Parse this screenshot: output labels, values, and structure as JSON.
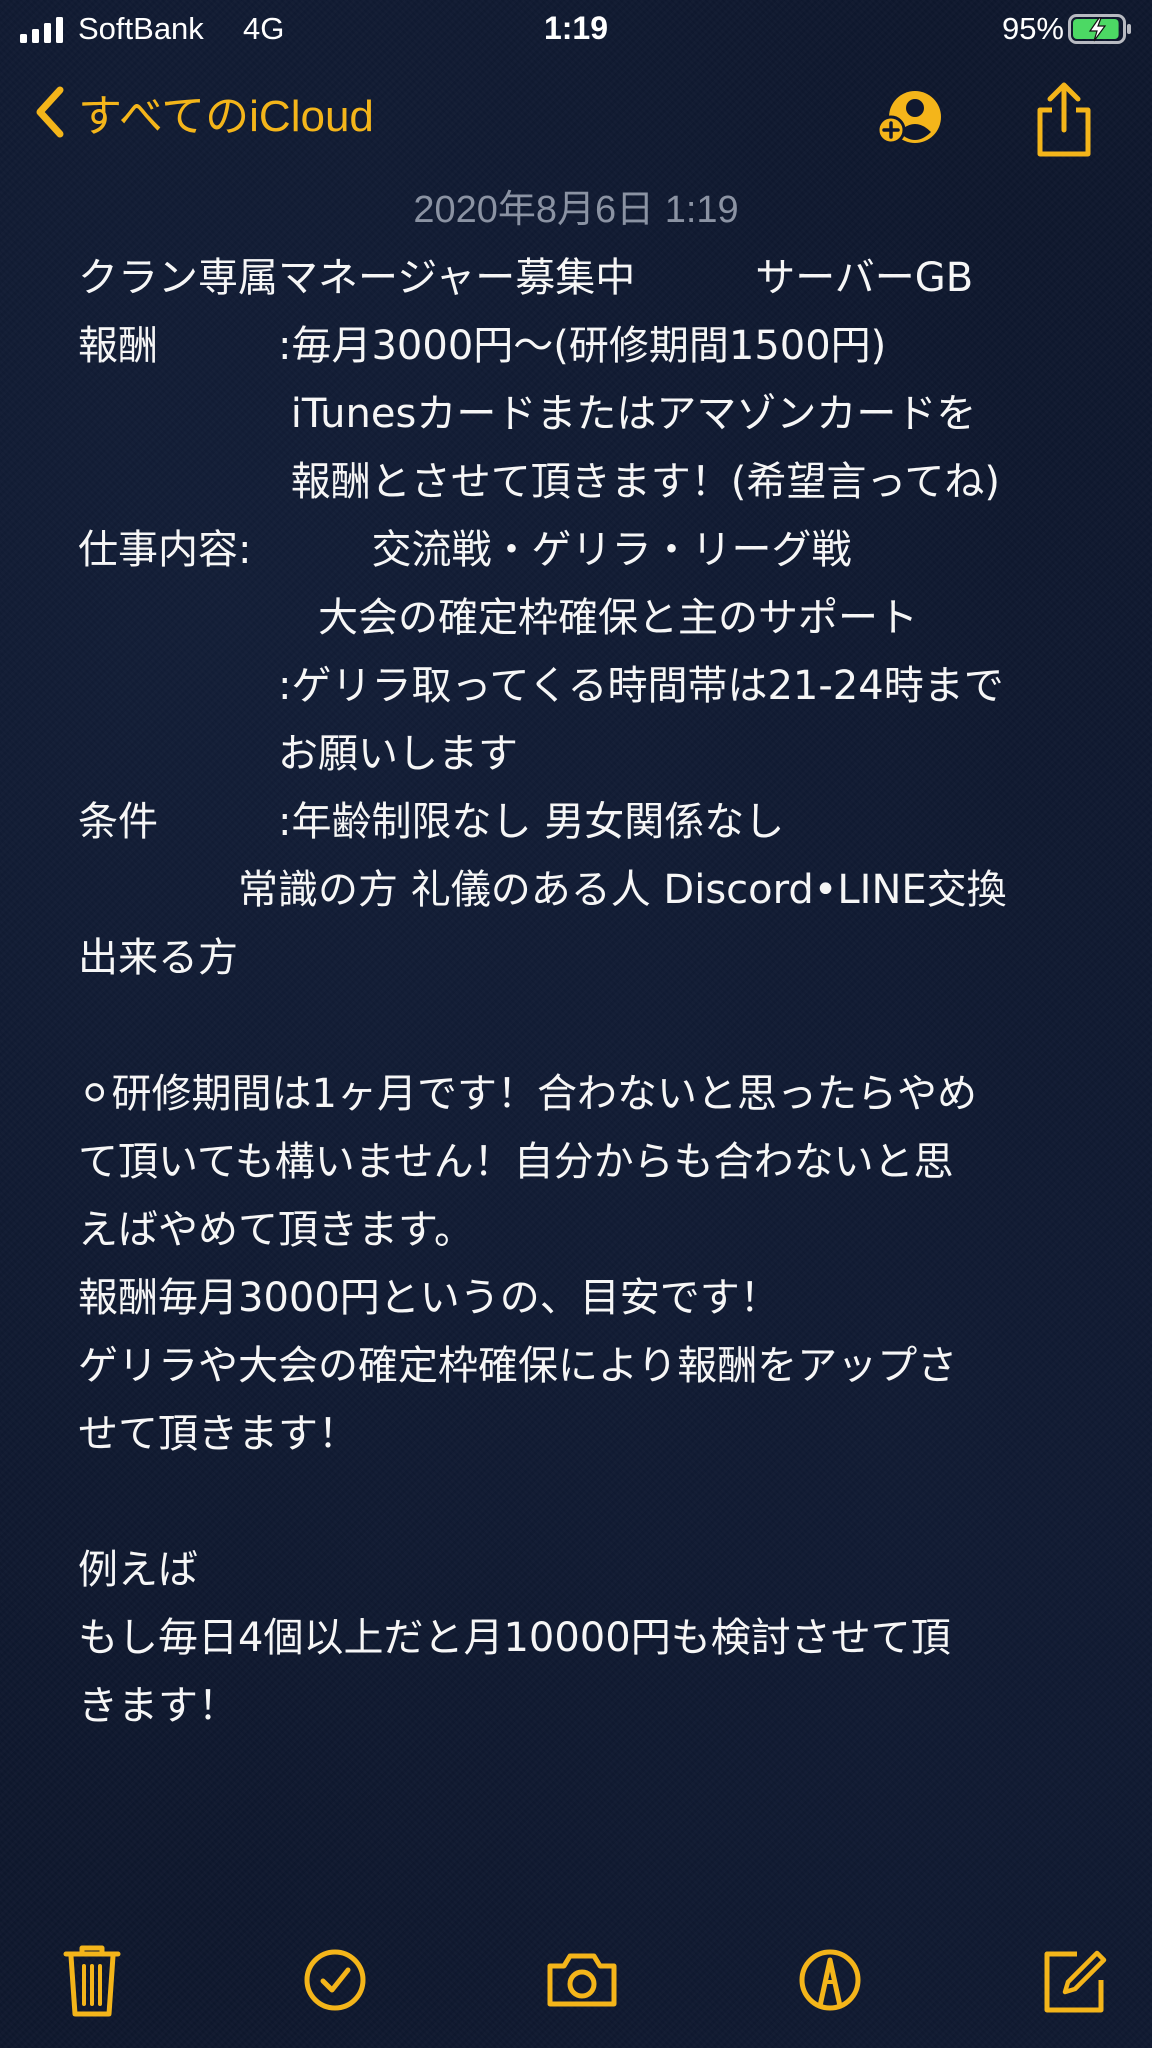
{
  "status_bar": {
    "carrier": "SoftBank",
    "network": "4G",
    "time": "1:19",
    "battery_percent": "95%",
    "battery_level": 0.95,
    "charging": true
  },
  "nav": {
    "back_label": "すべてのiCloud",
    "back_icon": "chevron-left-icon",
    "collaborate_icon": "add-person-icon",
    "share_icon": "share-icon"
  },
  "note": {
    "date": "2020年8月6日 1:19",
    "lines": [
      "クラン専属マネージャー募集中　　　サーバーGB",
      "報酬　　　:毎月3000円〜(研修期間1500円)",
      "　　　　　 iTunesカードまたはアマゾンカードを",
      "　　　　　 報酬とさせて頂きます！(希望言ってね)",
      "仕事内容:　　　交流戦・ゲリラ・リーグ戦",
      "　　　　　　大会の確定枠確保と主のサポート",
      "　　　　　:ゲリラ取ってくる時間帯は21-24時まで",
      "　　　　　お願いします",
      "条件　　　:年齢制限なし 男女関係なし",
      "　　　　常識の方 礼儀のある人 Discord•LINE交換",
      "出来る方",
      "",
      "⚪︎研修期間は1ヶ月です！合わないと思ったらやめ",
      "て頂いても構いません！自分からも合わないと思",
      "えばやめて頂きます。",
      "報酬毎月3000円というの、目安です！",
      "ゲリラや大会の確定枠確保により報酬をアップさ",
      "せて頂きます！",
      "",
      "例えば",
      "もし毎日4個以上だと月10000円も検討させて頂",
      "きます！"
    ]
  },
  "toolbar": {
    "items": [
      {
        "icon": "trash-icon"
      },
      {
        "icon": "checklist-icon"
      },
      {
        "icon": "camera-icon"
      },
      {
        "icon": "markup-icon"
      },
      {
        "icon": "compose-icon"
      }
    ]
  },
  "colors": {
    "accent": "#f4b51a",
    "background": "#0f1830",
    "text": "#f6f6f6",
    "date_text": "#8b93a3",
    "battery_fill": "#4cd964"
  }
}
